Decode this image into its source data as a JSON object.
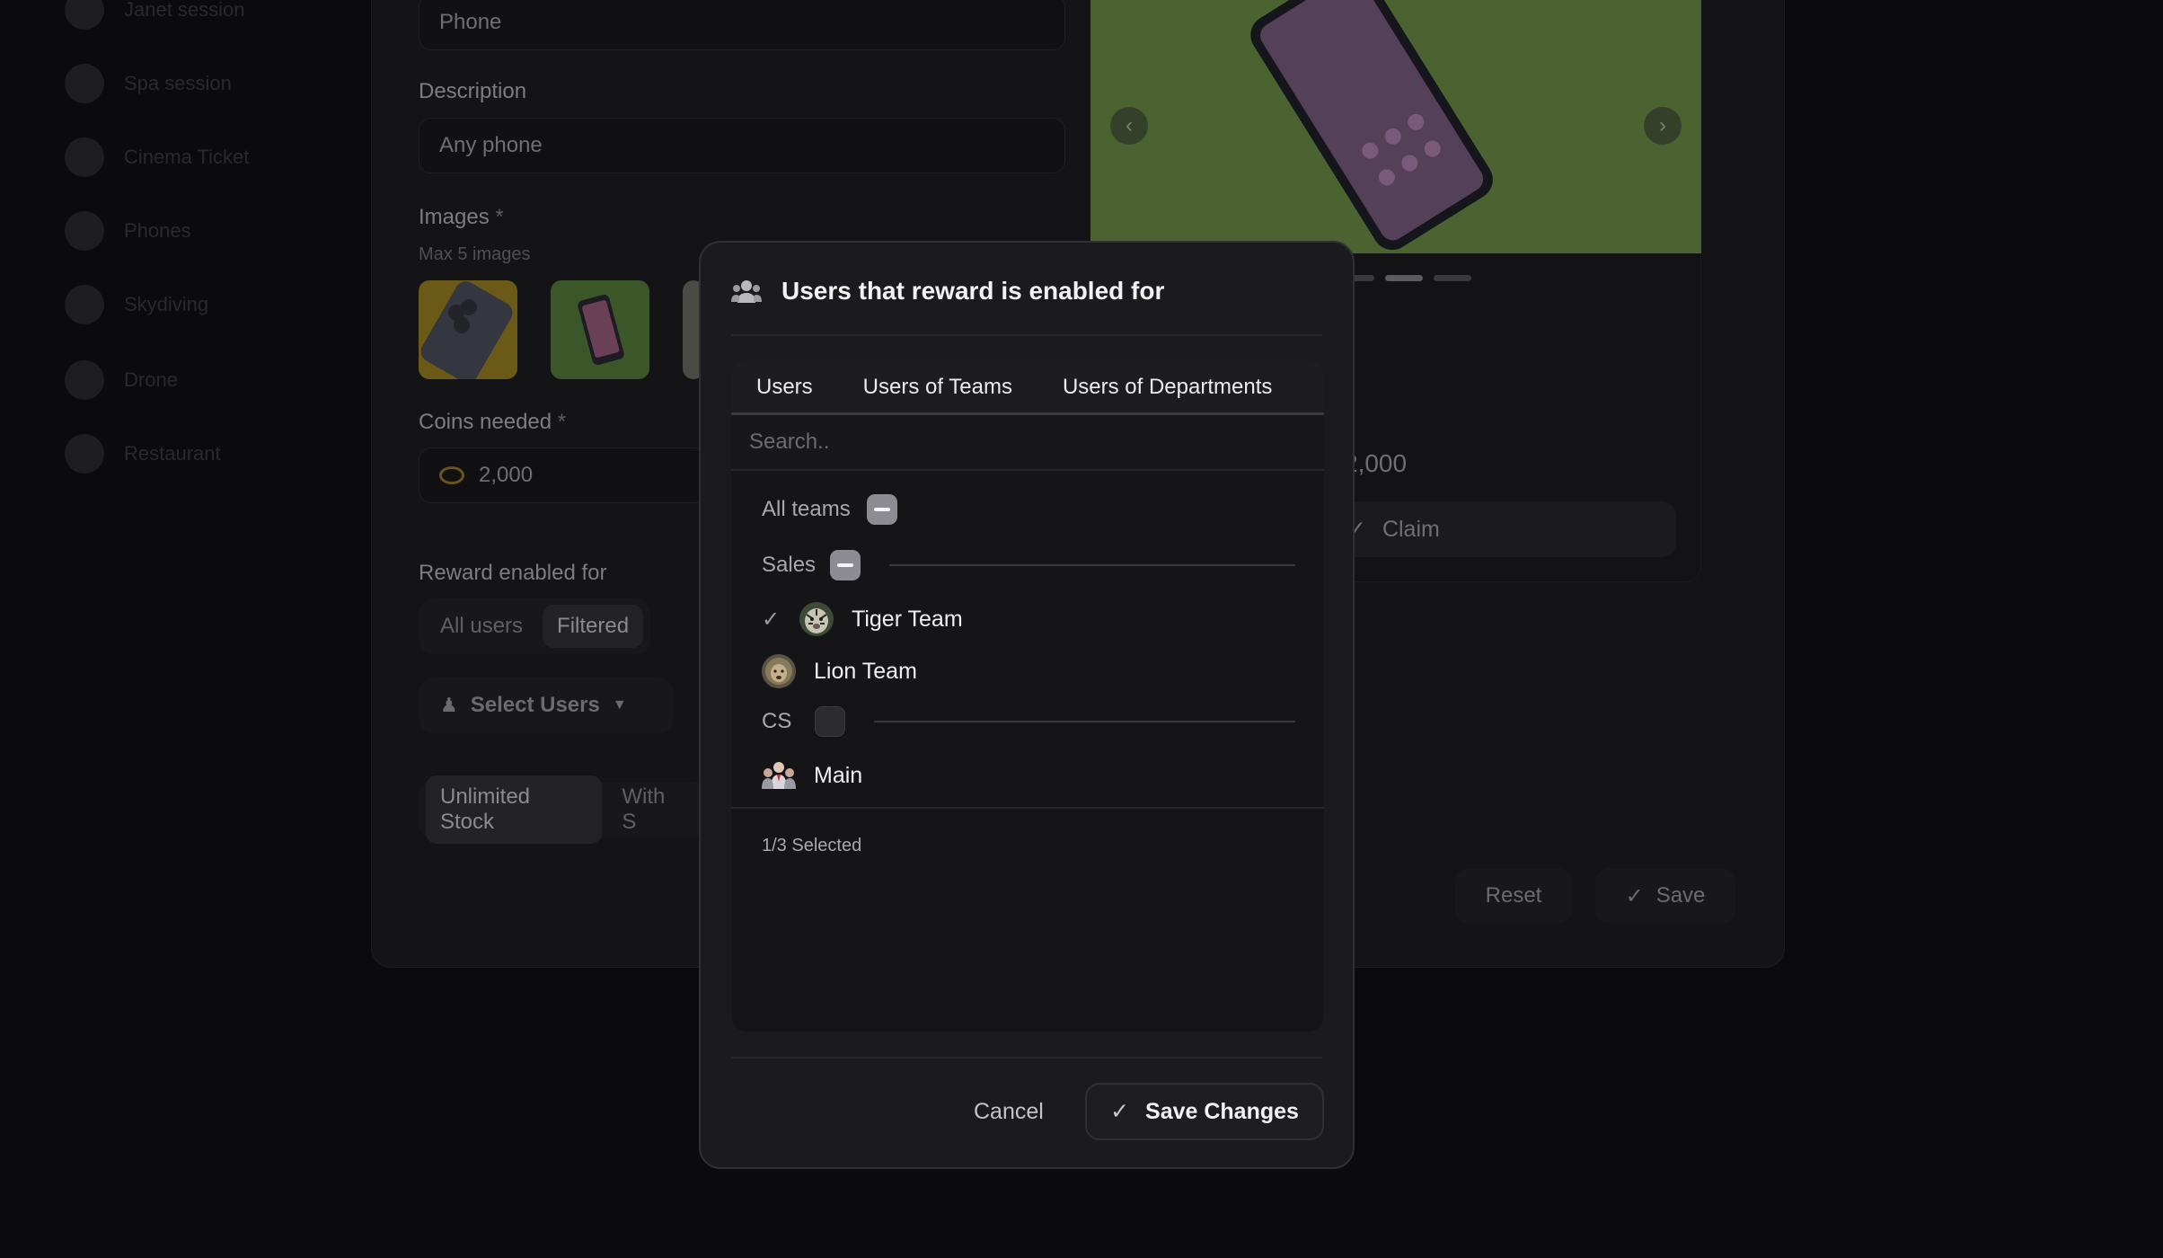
{
  "background": {
    "sidebar": {
      "items": [
        {
          "label": "Janet session",
          "icon": "session-icon"
        },
        {
          "label": "Spa session",
          "icon": "spa-icon"
        },
        {
          "label": "Cinema Ticket",
          "icon": "ticket-icon"
        },
        {
          "label": "Phones",
          "icon": "phone-icon"
        },
        {
          "label": "Skydiving",
          "icon": "skydiving-icon"
        },
        {
          "label": "Drone",
          "icon": "drone-icon"
        },
        {
          "label": "Restaurant",
          "icon": "restaurant-icon"
        }
      ]
    },
    "form": {
      "name_value": "Phone",
      "description_label": "Description",
      "description_value": "Any phone",
      "images_label": "Images",
      "required_mark": "*",
      "images_hint": "Max 5 images",
      "coins_label": "Coins needed",
      "coins_value": "2,000",
      "reward_enabled_label": "Reward enabled for",
      "reward_options": [
        "All users",
        "Filtered"
      ],
      "select_users_label": "Select Users",
      "stock_options": [
        "Unlimited Stock",
        "With S"
      ]
    },
    "preview": {
      "price": "2,000",
      "claim_label": "Claim"
    },
    "actions": {
      "reset_label": "Reset",
      "save_label": "Save"
    }
  },
  "modal": {
    "title": "Users that reward is enabled for",
    "tabs": [
      "Users",
      "Users of Teams",
      "Users of Departments"
    ],
    "active_tab": "Users of Teams",
    "search_placeholder": "Search..",
    "all_teams_label": "All teams",
    "groups": [
      {
        "label": "Sales",
        "state": "partial",
        "teams": [
          {
            "name": "Tiger Team",
            "selected": true,
            "avatar": "tiger-avatar"
          },
          {
            "name": "Lion Team",
            "selected": false,
            "avatar": "lion-avatar"
          }
        ]
      },
      {
        "label": "CS",
        "state": "empty",
        "teams": [
          {
            "name": "Main",
            "selected": false,
            "avatar": "group-avatar"
          }
        ]
      }
    ],
    "selected_count": "1/3 Selected",
    "cancel_label": "Cancel",
    "save_label": "Save Changes"
  },
  "colors": {
    "accent": "#7c6bd9",
    "modal_bg": "#1b1b1e",
    "page_bg": "#0b0b0d"
  }
}
